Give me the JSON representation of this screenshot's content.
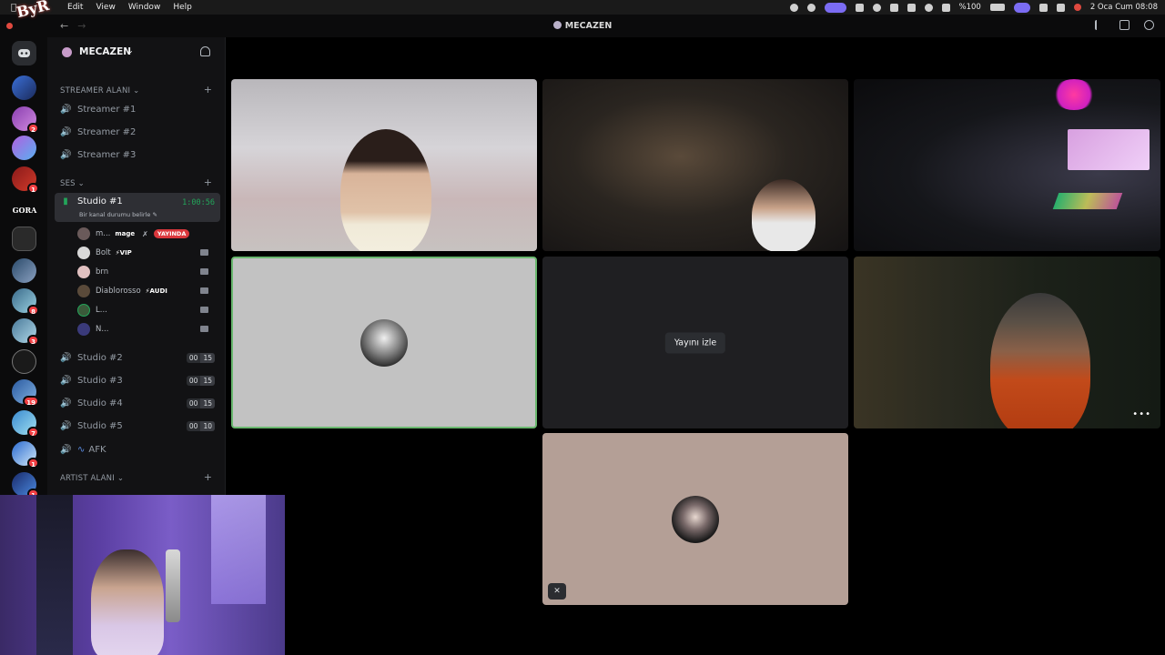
{
  "menubar": {
    "items": [
      "Edit",
      "View",
      "Window",
      "Help"
    ],
    "battery": "%100",
    "datetime": "2 Oca Cum  08:08"
  },
  "window": {
    "title": "MECAZEN"
  },
  "guilds": {
    "badges": [
      "2",
      "1",
      "8",
      "3",
      "19",
      "7",
      "1",
      "1"
    ],
    "text_icons": [
      "GORA"
    ]
  },
  "server": {
    "name": "MECAZEN",
    "categories": [
      {
        "label": "STREAMER ALANI"
      },
      {
        "label": "SES"
      },
      {
        "label": "ARTIST ALANI"
      }
    ],
    "streamer_channels": [
      "Streamer #1",
      "Streamer #2",
      "Streamer #3"
    ],
    "active_channel": {
      "name": "Studio #1",
      "timer": "1:00:56",
      "status": "Bir kanal durumu belirle"
    },
    "members": [
      {
        "name": "m...",
        "tag": "mage",
        "live": "YAYINDA"
      },
      {
        "name": "Bolt",
        "tag": "⚡VIP"
      },
      {
        "name": "brn",
        "tag": ""
      },
      {
        "name": "Diablorosso",
        "tag": "⚡AUDI"
      },
      {
        "name": "L...",
        "tag": ""
      },
      {
        "name": "N...",
        "tag": ""
      }
    ],
    "studio_channels": [
      {
        "name": "Studio #2",
        "a": "00",
        "b": "15"
      },
      {
        "name": "Studio #3",
        "a": "00",
        "b": "15"
      },
      {
        "name": "Studio #4",
        "a": "00",
        "b": "15"
      },
      {
        "name": "Studio #5",
        "a": "00",
        "b": "10"
      }
    ],
    "afk_channel": "AFK"
  },
  "stage": {
    "watch_label": "Yayını izle"
  },
  "colors": {
    "accent_green": "#23a55a",
    "live_red": "#da373c",
    "sidebar_bg": "#121214"
  }
}
